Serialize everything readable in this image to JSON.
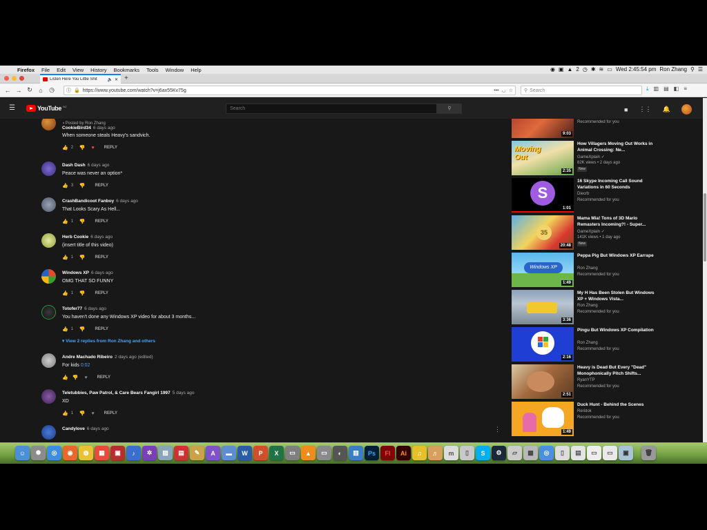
{
  "menubar": {
    "app": "Firefox",
    "items": [
      "File",
      "Edit",
      "View",
      "History",
      "Bookmarks",
      "Tools",
      "Window",
      "Help"
    ],
    "battery": "2",
    "clock": "Wed 2:45:54 pm",
    "user": "Ron Zhang"
  },
  "browser": {
    "tab_title": "Listen Here You Little Shit",
    "url": "https://www.youtube.com/watch?v=j6ax55Kv75g",
    "search_placeholder": "Search"
  },
  "youtube": {
    "logo_text": "YouTube",
    "logo_region": "NZ",
    "search_placeholder": "Search"
  },
  "comments": {
    "pinned_note": "Posted by Ron Zhang",
    "reply_label": "REPLY",
    "view_replies": "View 2 replies from Ron Zhang and others",
    "items": [
      {
        "author": "CookieBird34",
        "time": "6 days ago",
        "text": "When someone steals Heavy's sandvich.",
        "likes": "2",
        "hearted": true
      },
      {
        "author": "Dash Dash",
        "time": "6 days ago",
        "text": "Peace was never an option*",
        "likes": "3",
        "hearted": false
      },
      {
        "author": "CrashBandicoot Fanboy",
        "time": "6 days ago",
        "text": "That Looks Scary As Hell...",
        "likes": "1",
        "hearted": false
      },
      {
        "author": "Herb Cookie",
        "time": "6 days ago",
        "text": "(insert title of this video)",
        "likes": "1",
        "hearted": false
      },
      {
        "author": "Windows XP",
        "time": "6 days ago",
        "text": "OMG THAT SO FUNNY",
        "likes": "1",
        "hearted": false
      },
      {
        "author": "Totofer77",
        "time": "6 days ago",
        "text": "You haven't done any Windows XP video for about 3 months...",
        "likes": "1",
        "hearted": false
      },
      {
        "author": "Andre Machado Ribeiro",
        "time": "2 days ago (edited)",
        "text": "For kids ",
        "link": "0:02",
        "likes": "",
        "hearted": false
      },
      {
        "author": "Teletubbies, Paw Patrol, & Care Bears Fangirl 1997",
        "time": "5 days ago",
        "text": "XD",
        "likes": "1",
        "hearted": false
      },
      {
        "author": "Candylove",
        "time": "6 days ago",
        "text": "",
        "likes": "",
        "hearted": false
      }
    ]
  },
  "sidebar": {
    "videos": [
      {
        "title": "",
        "channel": "",
        "meta": "Recommended for you",
        "duration": "9:03",
        "badge": ""
      },
      {
        "title": "How Villagers Moving Out Works in Animal Crossing: Ne...",
        "channel": "GameXplain",
        "meta": "82K views • 2 days ago",
        "duration": "2:35",
        "badge": "New"
      },
      {
        "title": "16 Skype Incoming Call Sound Variations in 60 Seconds",
        "channel": "Diecrb",
        "meta": "Recommended for you",
        "duration": "1:01",
        "badge": ""
      },
      {
        "title": "Mama Mia! Tons of 3D Mario Remasters Incoming?! - Super...",
        "channel": "GameXplain",
        "meta": "141K views • 1 day ago",
        "duration": "20:48",
        "badge": "New"
      },
      {
        "title": "Peppa Pig But Windows XP Earrape",
        "channel": "Ron Zhang",
        "meta": "Recommended for you",
        "duration": "1:49",
        "badge": ""
      },
      {
        "title": "My H Has Been Stolen But Windows XP + Windows Vista...",
        "channel": "Ron Zhang",
        "meta": "Recommended for you",
        "duration": "3:36",
        "badge": ""
      },
      {
        "title": "Pingu But Windows XP Compilation",
        "channel": "Ron Zhang",
        "meta": "Recommended for you",
        "duration": "2:16",
        "badge": ""
      },
      {
        "title": "Heavy is Dead But Every \"Dead\" Monophonically Pitch Shifts...",
        "channel": "RyanYTP",
        "meta": "Recommended for you",
        "duration": "2:51",
        "badge": ""
      },
      {
        "title": "Duck Hunt - Behind the Scenes",
        "channel": "Reridok",
        "meta": "Recommended for you",
        "duration": "1:49",
        "badge": ""
      }
    ]
  }
}
